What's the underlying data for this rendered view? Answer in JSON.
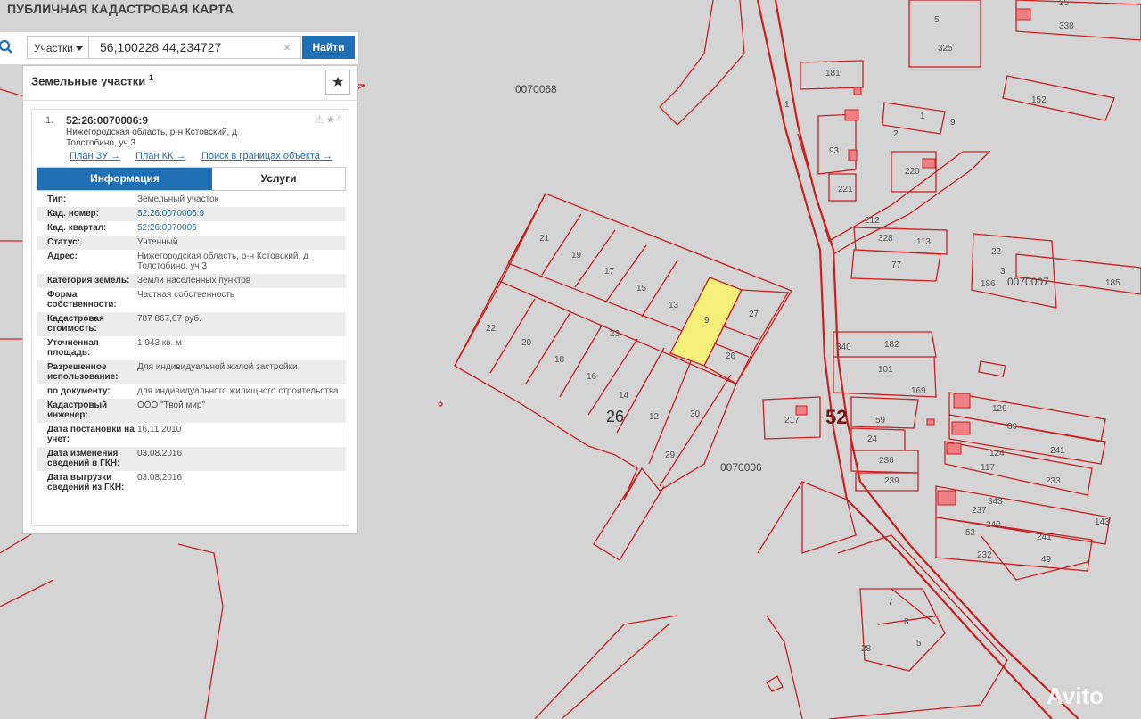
{
  "app": {
    "title": "ПУБЛИЧНАЯ КАДАСТРОВАЯ КАРТА"
  },
  "search": {
    "type": "Участки",
    "query": "56,100228 44,234727",
    "clear": "×",
    "button": "Найти"
  },
  "panel": {
    "header": "Земельные участки",
    "header_count": "1",
    "star": "★",
    "card": {
      "number": "1.",
      "cad_number": "52:26:0070006:9",
      "address": "Нижегородская область, р-н Кстовский, д Толстобино, уч 3",
      "icons": "⚠★^",
      "links": [
        "План ЗУ →",
        "План КК →",
        "Поиск в границах объекта →"
      ],
      "tabs": [
        "Информация",
        "Услуги"
      ],
      "rows": [
        {
          "k": "Тип:",
          "v": "Земельный участок"
        },
        {
          "k": "Кад. номер:",
          "v": "52:26:0070006:9"
        },
        {
          "k": "Кад. квартал:",
          "v": "52:26:0070006"
        },
        {
          "k": "Статус:",
          "v": "Учтенный"
        },
        {
          "k": "Адрес:",
          "v": "Нижегородская область, р-н Кстовский, д Толстобино, уч 3"
        },
        {
          "k": "Категория земель:",
          "v": "Земли населённых пунктов"
        },
        {
          "k": "Форма собственности:",
          "v": "Частная собственность"
        },
        {
          "k": "Кадастровая стоимость:",
          "v": "787 867,07 руб."
        },
        {
          "k": "Уточненная площадь:",
          "v": "1 943 кв. м"
        },
        {
          "k": "Разрешенное использование:",
          "v": "Для индивидуальной жилой застройки"
        },
        {
          "k": "по документу:",
          "v": "для индивидуального жилищного строительства"
        },
        {
          "k": "Кадастровый инженер:",
          "v": "ООО \"Твой мир\""
        },
        {
          "k": "Дата постановки на учет:",
          "v": "16.11.2010"
        },
        {
          "k": "Дата изменения сведений в ГКН:",
          "v": "03.08.2016"
        },
        {
          "k": "Дата выгрузки сведений из ГКН:",
          "v": "03.08.2016"
        }
      ]
    }
  },
  "map": {
    "quarters": [
      "0070068",
      "0070006",
      "0070007"
    ],
    "big_labels": [
      "26",
      "52"
    ],
    "parcels": [
      "21",
      "19",
      "17",
      "15",
      "13",
      "9",
      "27",
      "22",
      "20",
      "18",
      "16",
      "14",
      "12",
      "30",
      "29",
      "26",
      "23",
      "181",
      "93",
      "221",
      "1",
      "9",
      "2",
      "220",
      "212",
      "328",
      "113",
      "77",
      "22",
      "3",
      "186",
      "185",
      "152",
      "340",
      "182",
      "101",
      "169",
      "217",
      "59",
      "24",
      "236",
      "239",
      "129",
      "89",
      "241",
      "124",
      "117",
      "233",
      "343",
      "237",
      "240",
      "241",
      "143",
      "52",
      "232",
      "49",
      "7",
      "8",
      "5",
      "28",
      "5",
      "325",
      "25",
      "338",
      "1"
    ],
    "colors": {
      "border": "#cc1f1f",
      "selected": "#f5f07a",
      "building": "#f07f84",
      "background": "#d4d4d4"
    }
  },
  "watermark": "Avito"
}
